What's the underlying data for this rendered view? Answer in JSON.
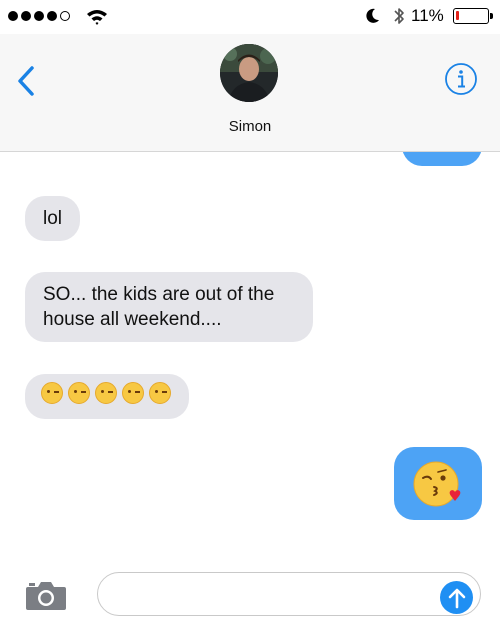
{
  "status_bar": {
    "signal_bars": 4,
    "signal_total": 5,
    "battery_text": "11%",
    "battery_level": 0.11,
    "battery_color": "#e2231a"
  },
  "header": {
    "contact_name": "Simon",
    "back_icon": "chevron-left-icon",
    "info_icon": "info-icon",
    "accent_color": "#1a82e5"
  },
  "messages": [
    {
      "direction": "outgoing",
      "text": ""
    },
    {
      "direction": "incoming",
      "text": "lol"
    },
    {
      "direction": "incoming",
      "text": "SO... the kids are out of the house all weekend...."
    },
    {
      "direction": "incoming",
      "emoji": "winking-face",
      "emoji_count": 5
    },
    {
      "direction": "outgoing",
      "emoji": "face-blowing-a-kiss",
      "emoji_count": 1
    }
  ],
  "input_bar": {
    "placeholder": "",
    "value": "",
    "camera_icon": "camera-icon",
    "send_icon": "send-arrow-icon"
  },
  "colors": {
    "incoming_bubble": "#e5e5ea",
    "outgoing_bubble": "#4da3f5",
    "send_button": "#1f8ff3"
  }
}
